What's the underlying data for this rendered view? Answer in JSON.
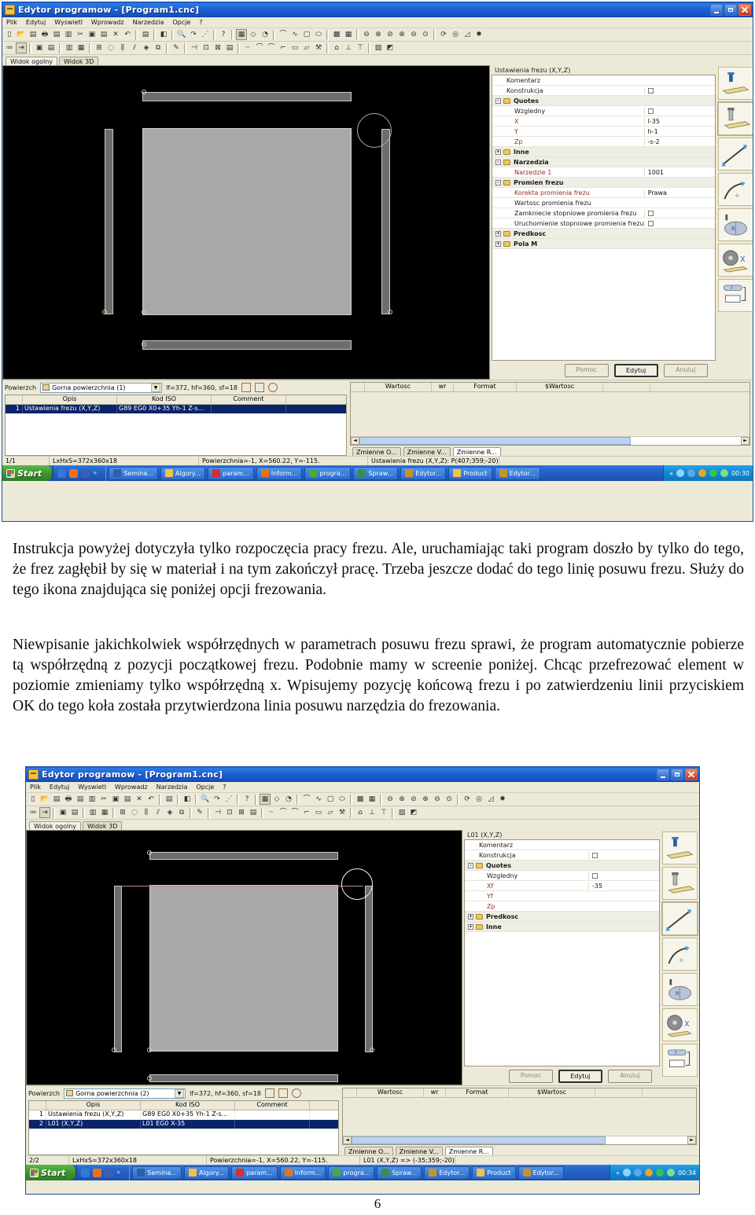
{
  "page": {
    "number": "6"
  },
  "body_text": {
    "paragraph1": "Instrukcja powyżej dotyczyła tylko rozpoczęcia pracy frezu. Ale, uruchamiając taki program doszło by tylko do tego, że frez zagłębił by się w materiał i na tym zakończył pracę. Trzeba jeszcze dodać do tego linię posuwu frezu. Służy do tego ikona znajdująca się poniżej opcji frezowania.",
    "paragraph2": "Niewpisanie jakichkolwiek współrzędnych w parametrach posuwu frezu sprawi, że program automatycznie pobierze tą współrzędną z pozycji początkowej frezu. Podobnie mamy w screenie poniżej. Chcąc przefrezować element w poziomie zmieniamy tylko współrzędną x. Wpisujemy pozycję końcową frezu i po zatwierdzeniu linii przyciskiem OK do tego koła została przytwierdzona linia posuwu narzędzia do frezowania."
  },
  "screenshot1": {
    "title": "Edytor programow - [Program1.cnc]",
    "window_buttons": {
      "minimize": "minimize-button",
      "maximize": "maximize-button",
      "close": "close-button"
    },
    "menu": [
      "Plik",
      "Edytuj",
      "Wyswietl",
      "Wprowadz",
      "Narzedzia",
      "Opcje",
      "?"
    ],
    "tabs": [
      {
        "label": "Widok ogolny",
        "active": true
      },
      {
        "label": "Widok 3D",
        "active": false
      }
    ],
    "property_panel": {
      "title": "Ustawienia frezu (X,Y,Z)",
      "rows": [
        {
          "label": "Komentarz",
          "value": "",
          "indent": 1,
          "type": "text",
          "group": false,
          "red": false
        },
        {
          "label": "Konstrukcja",
          "value": "",
          "indent": 1,
          "type": "checkbox",
          "group": false,
          "red": false
        },
        {
          "label": "Quotes",
          "value": "",
          "indent": 0,
          "type": "folder",
          "group": true,
          "expander": "-",
          "red": false
        },
        {
          "label": "Wzgledny",
          "value": "",
          "indent": 2,
          "type": "checkbox",
          "group": false,
          "red": false
        },
        {
          "label": "X",
          "value": "l-35",
          "indent": 2,
          "type": "text",
          "group": false,
          "red": true
        },
        {
          "label": "Y",
          "value": "h-1",
          "indent": 2,
          "type": "text",
          "group": false,
          "red": true
        },
        {
          "label": "Zp",
          "value": "-s-2",
          "indent": 2,
          "type": "text",
          "group": false,
          "red": true
        },
        {
          "label": "Inne",
          "value": "",
          "indent": 0,
          "type": "folder",
          "group": true,
          "expander": "+",
          "red": false
        },
        {
          "label": "Narzedzia",
          "value": "",
          "indent": 0,
          "type": "folder",
          "group": true,
          "expander": "-",
          "red": false
        },
        {
          "label": "Narzedzie 1",
          "value": "1001",
          "indent": 2,
          "type": "text",
          "group": false,
          "red": true
        },
        {
          "label": "Promien frezu",
          "value": "",
          "indent": 0,
          "type": "folder",
          "group": true,
          "expander": "-",
          "red": false
        },
        {
          "label": "Korekta promienia frezu",
          "value": "Prawa",
          "indent": 2,
          "type": "text",
          "group": false,
          "red": true
        },
        {
          "label": "Wartosc promienia frezu",
          "value": "",
          "indent": 2,
          "type": "text",
          "group": false,
          "red": false
        },
        {
          "label": "Zamkniecie stopniowe promienia frezu",
          "value": "",
          "indent": 2,
          "type": "checkbox",
          "group": false,
          "red": false
        },
        {
          "label": "Uruchomienie stopniowe promienia frezu",
          "value": "",
          "indent": 2,
          "type": "checkbox",
          "group": false,
          "red": false
        },
        {
          "label": "Predkosc",
          "value": "",
          "indent": 0,
          "type": "folder",
          "group": true,
          "expander": "+",
          "red": false
        },
        {
          "label": "Pola M",
          "value": "",
          "indent": 0,
          "type": "folder",
          "group": true,
          "expander": "+",
          "red": false
        }
      ]
    },
    "rail_icons": [
      {
        "name": "drill-hole-icon",
        "selected": false
      },
      {
        "name": "milling-plunge-icon",
        "selected": true
      },
      {
        "name": "feed-line-icon",
        "selected": false
      },
      {
        "name": "feed-arc-icon",
        "selected": false
      },
      {
        "name": "radius-pocket-icon",
        "selected": false
      },
      {
        "name": "saw-blade-x-icon",
        "selected": false
      },
      {
        "name": "parameters-icon",
        "selected": false
      }
    ],
    "dialog_buttons": [
      {
        "label": "Pomoc",
        "primary": false
      },
      {
        "label": "Edytuj",
        "primary": true
      },
      {
        "label": "Anuluj",
        "primary": false
      }
    ],
    "grid_toolbar": {
      "label": "Powierzch",
      "surface_value": "Gorna powierzchnia (1)",
      "dimensions": "lf=372, hf=360, sf=18"
    },
    "grid_headers": [
      "",
      "Opis",
      "Kod ISO",
      "Comment"
    ],
    "grid_rows": [
      {
        "num": "1",
        "desc": "Ustawienia frezu (X,Y,Z)",
        "iso": "G89 EG0 X0+35  Yh-1  Z-s...",
        "comment": "",
        "selected": true
      }
    ],
    "var_headers": [
      "",
      "Wartosc",
      "wr",
      "Format",
      "$Wartosc",
      ""
    ],
    "var_tabs": [
      {
        "label": "Zmienne O...",
        "active": false
      },
      {
        "label": "Zmienne V...",
        "active": false
      },
      {
        "label": "Zmienne R...",
        "active": true
      }
    ],
    "statusbar": [
      "1/1",
      "LxHxS=372x360x18",
      "Powierzchnia=-1, X=560.22, Y=-115.",
      "Ustawienia frezu (X,Y,Z): P(407;359;-20)"
    ],
    "taskbar": {
      "start_label": "Start",
      "quicklaunch": [
        "ie-icon",
        "firefox-icon",
        "word-art-icon",
        "more-chevron-icon"
      ],
      "items": [
        {
          "label": "Semina...",
          "icon": "word-doc-icon"
        },
        {
          "label": "Algory...",
          "icon": "folder-icon"
        },
        {
          "label": "param...",
          "icon": "red-star-icon"
        },
        {
          "label": "Inform...",
          "icon": "firefox-icon"
        },
        {
          "label": "progra...",
          "icon": "green-app-icon"
        },
        {
          "label": "Spraw...",
          "icon": "excel-icon"
        },
        {
          "label": "Edytor...",
          "icon": "editor-icon"
        },
        {
          "label": "Product",
          "icon": "folder-icon"
        },
        {
          "label": "Edytor...",
          "icon": "editor-icon"
        }
      ],
      "tray_icons": [
        "volume-icon",
        "network-icon",
        "antivirus-icon",
        "update-icon",
        "media-icon"
      ],
      "clock": "00:30"
    }
  },
  "screenshot2": {
    "title": "Edytor programow - [Program1.cnc]",
    "menu": [
      "Plik",
      "Edytuj",
      "Wyswietl",
      "Wprowadz",
      "Narzedzia",
      "Opcje",
      "?"
    ],
    "tabs": [
      {
        "label": "Widok ogolny",
        "active": true
      },
      {
        "label": "Widok 3D",
        "active": false
      }
    ],
    "property_panel": {
      "title": "L01 (X,Y,Z)",
      "rows": [
        {
          "label": "Komentarz",
          "value": "",
          "indent": 1,
          "type": "text",
          "group": false,
          "red": false
        },
        {
          "label": "Konstrukcja",
          "value": "",
          "indent": 1,
          "type": "checkbox",
          "group": false,
          "red": false
        },
        {
          "label": "Quotes",
          "value": "",
          "indent": 0,
          "type": "folder",
          "group": true,
          "expander": "-",
          "red": false
        },
        {
          "label": "Wzgledny",
          "value": "",
          "indent": 2,
          "type": "checkbox",
          "group": false,
          "red": false
        },
        {
          "label": "Xf",
          "value": "-35",
          "indent": 2,
          "type": "text",
          "group": false,
          "red": true
        },
        {
          "label": "Yf",
          "value": "",
          "indent": 2,
          "type": "text",
          "group": false,
          "red": true
        },
        {
          "label": "Zp",
          "value": "",
          "indent": 2,
          "type": "text",
          "group": false,
          "red": true
        },
        {
          "label": "Predkosc",
          "value": "",
          "indent": 0,
          "type": "folder",
          "group": true,
          "expander": "+",
          "red": false
        },
        {
          "label": "Inne",
          "value": "",
          "indent": 0,
          "type": "folder",
          "group": true,
          "expander": "+",
          "red": false
        }
      ]
    },
    "rail_icons": [
      {
        "name": "drill-hole-icon",
        "selected": false
      },
      {
        "name": "milling-plunge-icon",
        "selected": false
      },
      {
        "name": "feed-line-icon",
        "selected": true
      },
      {
        "name": "feed-arc-icon",
        "selected": false
      },
      {
        "name": "radius-pocket-icon",
        "selected": false
      },
      {
        "name": "saw-blade-x-icon",
        "selected": false
      },
      {
        "name": "parameters-icon",
        "selected": false
      }
    ],
    "dialog_buttons": [
      {
        "label": "Pomoc",
        "primary": false
      },
      {
        "label": "Edytuj",
        "primary": true
      },
      {
        "label": "Anuluj",
        "primary": false
      }
    ],
    "grid_toolbar": {
      "label": "Powierzch",
      "surface_value": "Gorna powierzchnia (2)",
      "dimensions": "lf=372, hf=360, sf=18"
    },
    "grid_headers": [
      "",
      "Opis",
      "Kod ISO",
      "Comment"
    ],
    "grid_rows": [
      {
        "num": "1",
        "desc": "Ustawienia frezu (X,Y,Z)",
        "iso": "G89 EG0 X0+35  Yh-1  Z-s...",
        "comment": "",
        "selected": false
      },
      {
        "num": "2",
        "desc": "L01 (X,Y,Z)",
        "iso": "L01 EG0 X-35",
        "comment": "",
        "selected": true
      }
    ],
    "var_headers": [
      "",
      "Wartosc",
      "wr",
      "Format",
      "$Wartosc",
      ""
    ],
    "var_tabs": [
      {
        "label": "Zmienne O...",
        "active": false
      },
      {
        "label": "Zmienne V...",
        "active": false
      },
      {
        "label": "Zmienne R...",
        "active": true
      }
    ],
    "statusbar": [
      "2/2",
      "LxHxS=372x360x18",
      "Powierzchnia=-1, X=560.22, Y=-115.",
      "L01 (X,Y,Z) => (-35;359;-20)"
    ],
    "taskbar": {
      "start_label": "Start",
      "quicklaunch": [
        "ie-icon",
        "firefox-icon",
        "word-art-icon",
        "more-chevron-icon"
      ],
      "items": [
        {
          "label": "Semina...",
          "icon": "word-doc-icon"
        },
        {
          "label": "Algory...",
          "icon": "folder-icon"
        },
        {
          "label": "param...",
          "icon": "red-star-icon"
        },
        {
          "label": "Inform...",
          "icon": "firefox-icon"
        },
        {
          "label": "progra...",
          "icon": "green-app-icon"
        },
        {
          "label": "Spraw...",
          "icon": "excel-icon"
        },
        {
          "label": "Edytor...",
          "icon": "editor-icon"
        },
        {
          "label": "Product",
          "icon": "folder-icon"
        },
        {
          "label": "Edytor...",
          "icon": "editor-icon"
        }
      ],
      "tray_icons": [
        "volume-icon",
        "network-icon",
        "antivirus-icon",
        "update-icon",
        "media-icon"
      ],
      "clock": "00:34"
    }
  },
  "colors": {
    "title_blue": "#1550bf",
    "chrome": "#ece9d8",
    "selection": "#0a246a",
    "canvas": "#000000",
    "plate": "#a8a8a8",
    "bar": "#6d6d6d",
    "feed_line": "#b08792",
    "red_label": "#9b2b28"
  }
}
